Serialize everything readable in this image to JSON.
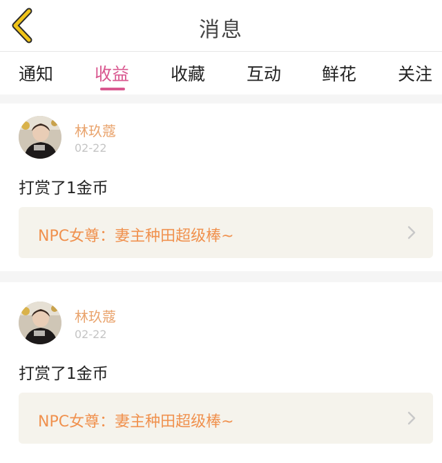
{
  "header": {
    "title": "消息",
    "back_icon": "chevron-left-icon",
    "back_color": "#f0c419"
  },
  "tabs": [
    {
      "label": "通知",
      "active": false
    },
    {
      "label": "收益",
      "active": true
    },
    {
      "label": "收藏",
      "active": false
    },
    {
      "label": "互动",
      "active": false
    },
    {
      "label": "鲜花",
      "active": false
    },
    {
      "label": "关注",
      "active": false
    }
  ],
  "accent_color": "#d9578f",
  "messages": [
    {
      "username": "林玖蔻",
      "date": "02-22",
      "text": "打赏了1金币",
      "book_title": "NPC女尊：妻主种田超级棒~"
    },
    {
      "username": "林玖蔻",
      "date": "02-22",
      "text": "打赏了1金币",
      "book_title": "NPC女尊：妻主种田超级棒~"
    }
  ]
}
